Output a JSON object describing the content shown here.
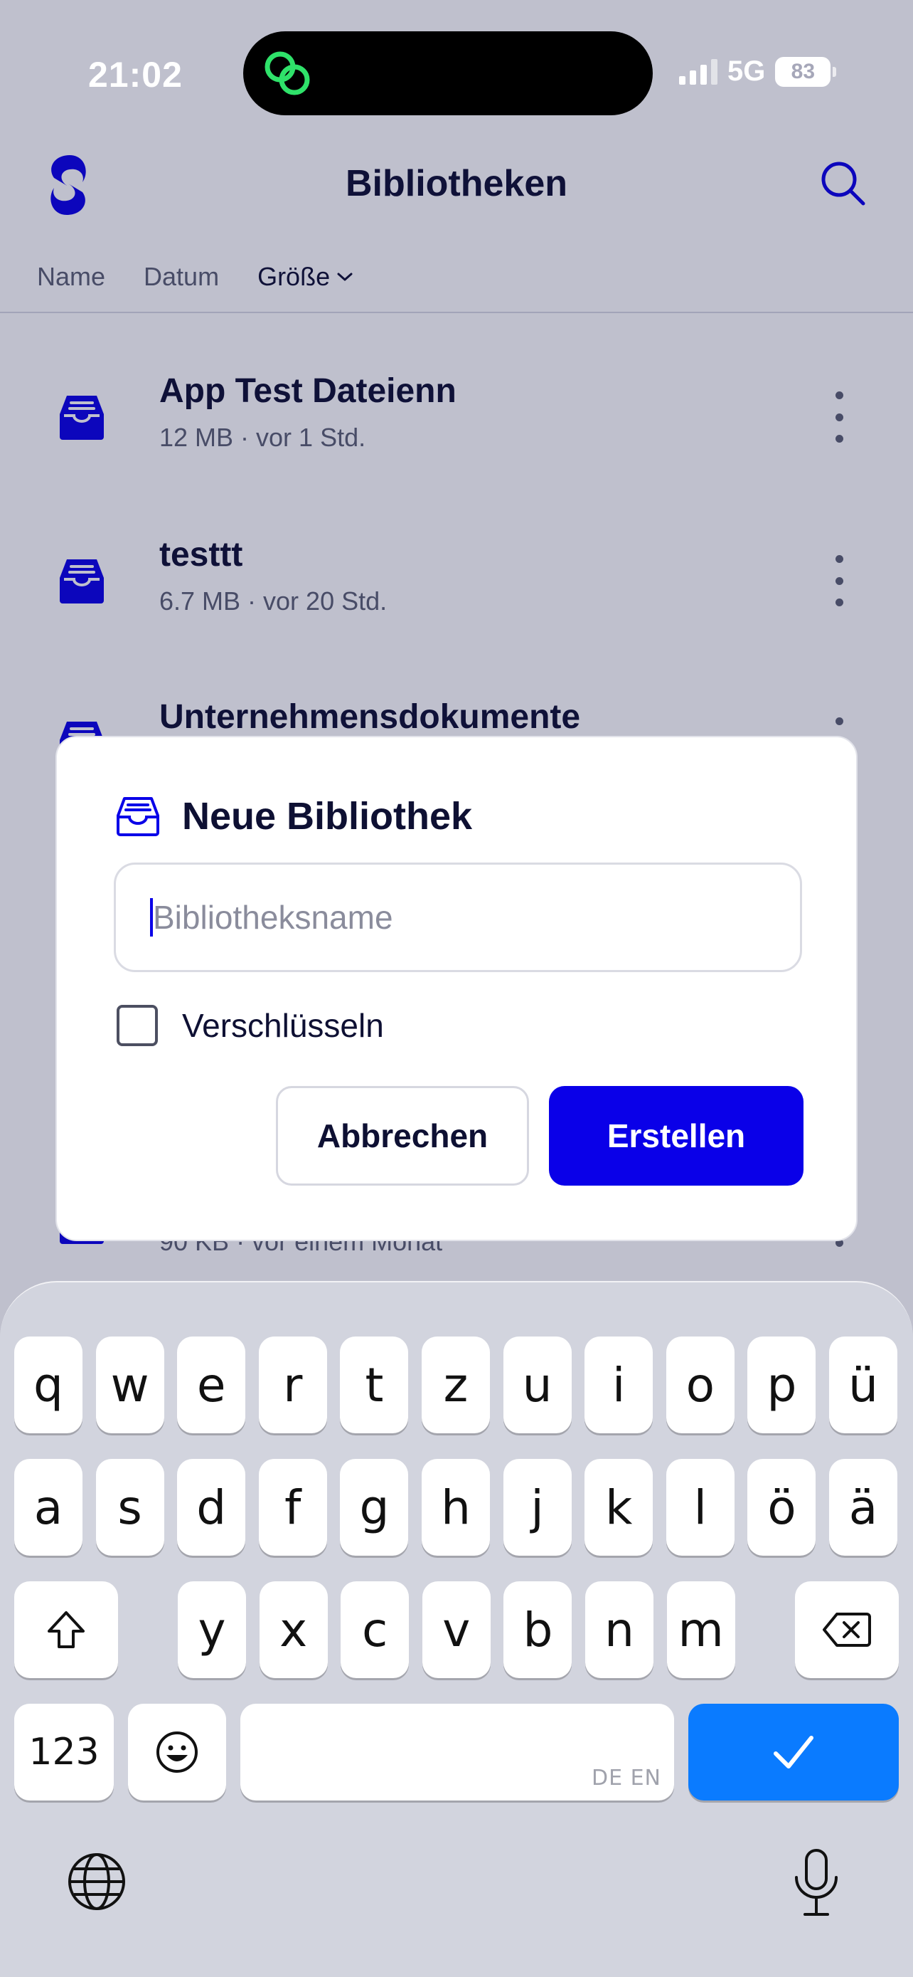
{
  "status_bar": {
    "time": "21:02",
    "network": "5G",
    "battery": "83"
  },
  "header": {
    "title": "Bibliotheken"
  },
  "sort_tabs": [
    {
      "label": "Name",
      "active": false
    },
    {
      "label": "Datum",
      "active": false
    },
    {
      "label": "Größe",
      "active": true
    }
  ],
  "libraries": [
    {
      "name": "App Test Dateienn",
      "meta": "12 MB · vor 1 Std."
    },
    {
      "name": "testtt",
      "meta": "6.7 MB · vor 20 Std."
    },
    {
      "name": "Unternehmensdokumente",
      "meta": ""
    },
    {
      "name": "",
      "meta": "90 KB · vor einem Monat"
    }
  ],
  "dialog": {
    "title": "Neue Bibliothek",
    "input_placeholder": "Bibliotheksname",
    "input_value": "",
    "checkbox_label": "Verschlüsseln",
    "checkbox_checked": false,
    "cancel_label": "Abbrechen",
    "create_label": "Erstellen"
  },
  "keyboard": {
    "row1": [
      "q",
      "w",
      "e",
      "r",
      "t",
      "z",
      "u",
      "i",
      "o",
      "p",
      "ü"
    ],
    "row2": [
      "a",
      "s",
      "d",
      "f",
      "g",
      "h",
      "j",
      "k",
      "l",
      "ö",
      "ä"
    ],
    "row3": [
      "y",
      "x",
      "c",
      "v",
      "b",
      "n",
      "m"
    ],
    "numbers_label": "123",
    "space_hint": "DE EN",
    "emoji_icon": "emoji-icon",
    "shift_icon": "shift-icon",
    "delete_icon": "delete-icon",
    "done_icon": "checkmark-icon",
    "globe_icon": "globe-icon",
    "mic_icon": "microphone-icon"
  },
  "colors": {
    "accent": "#0a00e8",
    "keyboard_done": "#0a7bff",
    "status_icon": "#2fe26a"
  }
}
